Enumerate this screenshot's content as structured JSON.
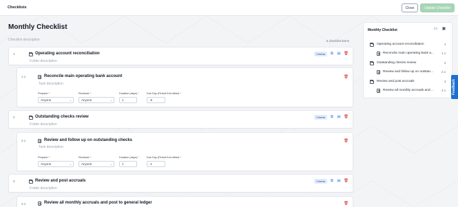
{
  "header": {
    "title": "Checklists",
    "close_label": "Close",
    "update_label": "Update Checklist"
  },
  "page": {
    "title": "Monthly Checklist",
    "description_placeholder": "Checklist description",
    "count": "6 checklist items"
  },
  "items": [
    {
      "number": "1",
      "title": "Operating account reconciliation",
      "description": "Folder description",
      "badge": "1 items",
      "task": {
        "number": "1.1",
        "title": "Reconcile main operating bank account",
        "description": "Task description",
        "preparer_label": "Preparer",
        "reviewer_label": "Reviewer",
        "duration_label": "Duration (days)",
        "dueday_label": "Due Day (Period End offset)",
        "preparer_value": "Anyone",
        "reviewer_value": "Anyone",
        "duration_value": "1",
        "dueday_value": "-5"
      }
    },
    {
      "number": "2",
      "title": "Outstanding checks review",
      "description": "Folder description",
      "badge": "1 items",
      "task": {
        "number": "2.1",
        "title": "Review and follow up on outstanding checks",
        "description": "Task description",
        "preparer_label": "Preparer",
        "reviewer_label": "Reviewer",
        "duration_label": "Duration (days)",
        "dueday_label": "Due Day (Period End offset)",
        "preparer_value": "Anyone",
        "reviewer_value": "Anyone",
        "duration_value": "1",
        "dueday_value": "-1"
      }
    },
    {
      "number": "3",
      "title": "Review and post accruals",
      "description": "Folder description",
      "badge": "1 items",
      "task": {
        "number": "3.1",
        "title": "Review all monthly accruals and post to general ledger"
      }
    }
  ],
  "required_mark": "*",
  "sidebar": {
    "title": "Monthly Checklist",
    "rows": [
      {
        "label": "Operating account reconciliation",
        "num": "1"
      },
      {
        "label": "Reconcile main operating bank a...",
        "num": "1.1"
      },
      {
        "label": "Outstanding checks review",
        "num": "2"
      },
      {
        "label": "Review and follow up on outstan...",
        "num": "2.1"
      },
      {
        "label": "Review and post accruals",
        "num": "3"
      },
      {
        "label": "Review all monthly accruals and ...",
        "num": "3.1"
      }
    ]
  },
  "feedback_label": "Feedback",
  "icons": {
    "folder": "folder-icon",
    "task": "task-icon",
    "copy": "copy-icon",
    "duplicate": "duplicate-icon",
    "delete": "trash-icon",
    "chevron": "chevron-down-icon"
  },
  "colors": {
    "accent": "#1d6fd1",
    "update_button": "#a7d6b7",
    "badge_bg": "#e0ecfb",
    "delete": "#dc2626"
  }
}
